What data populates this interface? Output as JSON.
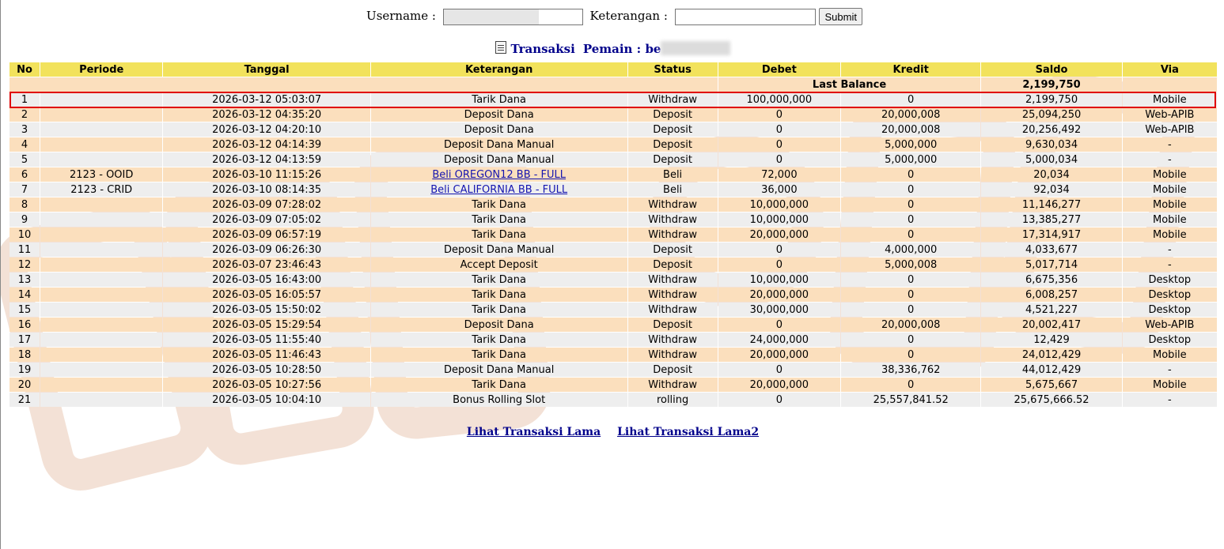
{
  "form": {
    "username_label": "Username :",
    "username_value": "",
    "keterangan_label": "Keterangan :",
    "keterangan_value": "",
    "submit_label": "Submit"
  },
  "title": {
    "transaksi": "Transaksi",
    "pemain_label": "Pemain :",
    "pemain_value": "be"
  },
  "columns": [
    "No",
    "Periode",
    "Tanggal",
    "Keterangan",
    "Status",
    "Debet",
    "Kredit",
    "Saldo",
    "Via"
  ],
  "last_balance": {
    "label": "Last Balance",
    "value": "2,199,750"
  },
  "rows": [
    {
      "no": "1",
      "periode": "",
      "tanggal": "2026-03-12 05:03:07",
      "keterangan": "Tarik Dana",
      "link": false,
      "status": "Withdraw",
      "debet": "100,000,000",
      "kredit": "0",
      "saldo": "2,199,750",
      "via": "Mobile"
    },
    {
      "no": "2",
      "periode": "",
      "tanggal": "2026-03-12 04:35:20",
      "keterangan": "Deposit Dana",
      "link": false,
      "status": "Deposit",
      "debet": "0",
      "kredit": "20,000,008",
      "saldo": "25,094,250",
      "via": "Web-APIB"
    },
    {
      "no": "3",
      "periode": "",
      "tanggal": "2026-03-12 04:20:10",
      "keterangan": "Deposit Dana",
      "link": false,
      "status": "Deposit",
      "debet": "0",
      "kredit": "20,000,008",
      "saldo": "20,256,492",
      "via": "Web-APIB"
    },
    {
      "no": "4",
      "periode": "",
      "tanggal": "2026-03-12 04:14:39",
      "keterangan": "Deposit Dana Manual",
      "link": false,
      "status": "Deposit",
      "debet": "0",
      "kredit": "5,000,000",
      "saldo": "9,630,034",
      "via": "-"
    },
    {
      "no": "5",
      "periode": "",
      "tanggal": "2026-03-12 04:13:59",
      "keterangan": "Deposit Dana Manual",
      "link": false,
      "status": "Deposit",
      "debet": "0",
      "kredit": "5,000,000",
      "saldo": "5,000,034",
      "via": "-"
    },
    {
      "no": "6",
      "periode": "2123 - OOID",
      "tanggal": "2026-03-10 11:15:26",
      "keterangan": "Beli OREGON12 BB - FULL",
      "link": true,
      "status": "Beli",
      "debet": "72,000",
      "kredit": "0",
      "saldo": "20,034",
      "via": "Mobile"
    },
    {
      "no": "7",
      "periode": "2123 - CRID",
      "tanggal": "2026-03-10 08:14:35",
      "keterangan": "Beli CALIFORNIA BB - FULL",
      "link": true,
      "status": "Beli",
      "debet": "36,000",
      "kredit": "0",
      "saldo": "92,034",
      "via": "Mobile"
    },
    {
      "no": "8",
      "periode": "",
      "tanggal": "2026-03-09 07:28:02",
      "keterangan": "Tarik Dana",
      "link": false,
      "status": "Withdraw",
      "debet": "10,000,000",
      "kredit": "0",
      "saldo": "11,146,277",
      "via": "Mobile"
    },
    {
      "no": "9",
      "periode": "",
      "tanggal": "2026-03-09 07:05:02",
      "keterangan": "Tarik Dana",
      "link": false,
      "status": "Withdraw",
      "debet": "10,000,000",
      "kredit": "0",
      "saldo": "13,385,277",
      "via": "Mobile"
    },
    {
      "no": "10",
      "periode": "",
      "tanggal": "2026-03-09 06:57:19",
      "keterangan": "Tarik Dana",
      "link": false,
      "status": "Withdraw",
      "debet": "20,000,000",
      "kredit": "0",
      "saldo": "17,314,917",
      "via": "Mobile"
    },
    {
      "no": "11",
      "periode": "",
      "tanggal": "2026-03-09 06:26:30",
      "keterangan": "Deposit Dana Manual",
      "link": false,
      "status": "Deposit",
      "debet": "0",
      "kredit": "4,000,000",
      "saldo": "4,033,677",
      "via": "-"
    },
    {
      "no": "12",
      "periode": "",
      "tanggal": "2026-03-07 23:46:43",
      "keterangan": "Accept Deposit",
      "link": false,
      "status": "Deposit",
      "debet": "0",
      "kredit": "5,000,008",
      "saldo": "5,017,714",
      "via": "-"
    },
    {
      "no": "13",
      "periode": "",
      "tanggal": "2026-03-05 16:43:00",
      "keterangan": "Tarik Dana",
      "link": false,
      "status": "Withdraw",
      "debet": "10,000,000",
      "kredit": "0",
      "saldo": "6,675,356",
      "via": "Desktop"
    },
    {
      "no": "14",
      "periode": "",
      "tanggal": "2026-03-05 16:05:57",
      "keterangan": "Tarik Dana",
      "link": false,
      "status": "Withdraw",
      "debet": "20,000,000",
      "kredit": "0",
      "saldo": "6,008,257",
      "via": "Desktop"
    },
    {
      "no": "15",
      "periode": "",
      "tanggal": "2026-03-05 15:50:02",
      "keterangan": "Tarik Dana",
      "link": false,
      "status": "Withdraw",
      "debet": "30,000,000",
      "kredit": "0",
      "saldo": "4,521,227",
      "via": "Desktop"
    },
    {
      "no": "16",
      "periode": "",
      "tanggal": "2026-03-05 15:29:54",
      "keterangan": "Deposit Dana",
      "link": false,
      "status": "Deposit",
      "debet": "0",
      "kredit": "20,000,008",
      "saldo": "20,002,417",
      "via": "Web-APIB"
    },
    {
      "no": "17",
      "periode": "",
      "tanggal": "2026-03-05 11:55:40",
      "keterangan": "Tarik Dana",
      "link": false,
      "status": "Withdraw",
      "debet": "24,000,000",
      "kredit": "0",
      "saldo": "12,429",
      "via": "Desktop"
    },
    {
      "no": "18",
      "periode": "",
      "tanggal": "2026-03-05 11:46:43",
      "keterangan": "Tarik Dana",
      "link": false,
      "status": "Withdraw",
      "debet": "20,000,000",
      "kredit": "0",
      "saldo": "24,012,429",
      "via": "Mobile"
    },
    {
      "no": "19",
      "periode": "",
      "tanggal": "2026-03-05 10:28:50",
      "keterangan": "Deposit Dana Manual",
      "link": false,
      "status": "Deposit",
      "debet": "0",
      "kredit": "38,336,762",
      "saldo": "44,012,429",
      "via": "-"
    },
    {
      "no": "20",
      "periode": "",
      "tanggal": "2026-03-05 10:27:56",
      "keterangan": "Tarik Dana",
      "link": false,
      "status": "Withdraw",
      "debet": "20,000,000",
      "kredit": "0",
      "saldo": "5,675,667",
      "via": "Mobile"
    },
    {
      "no": "21",
      "periode": "",
      "tanggal": "2026-03-05 10:04:10",
      "keterangan": "Bonus Rolling Slot",
      "link": false,
      "status": "rolling",
      "debet": "0",
      "kredit": "25,557,841.52",
      "saldo": "25,675,666.52",
      "via": "-"
    }
  ],
  "footer": {
    "link1": "Lihat Transaksi Lama",
    "link2": "Lihat Transaksi Lama2"
  },
  "colors": {
    "header_bg": "#f2e25c",
    "row_odd": "#fbdfbd",
    "row_even": "#eeeeee",
    "status_red": "#d40000",
    "value_blue": "#1515b0",
    "highlight_border": "#e00000"
  }
}
